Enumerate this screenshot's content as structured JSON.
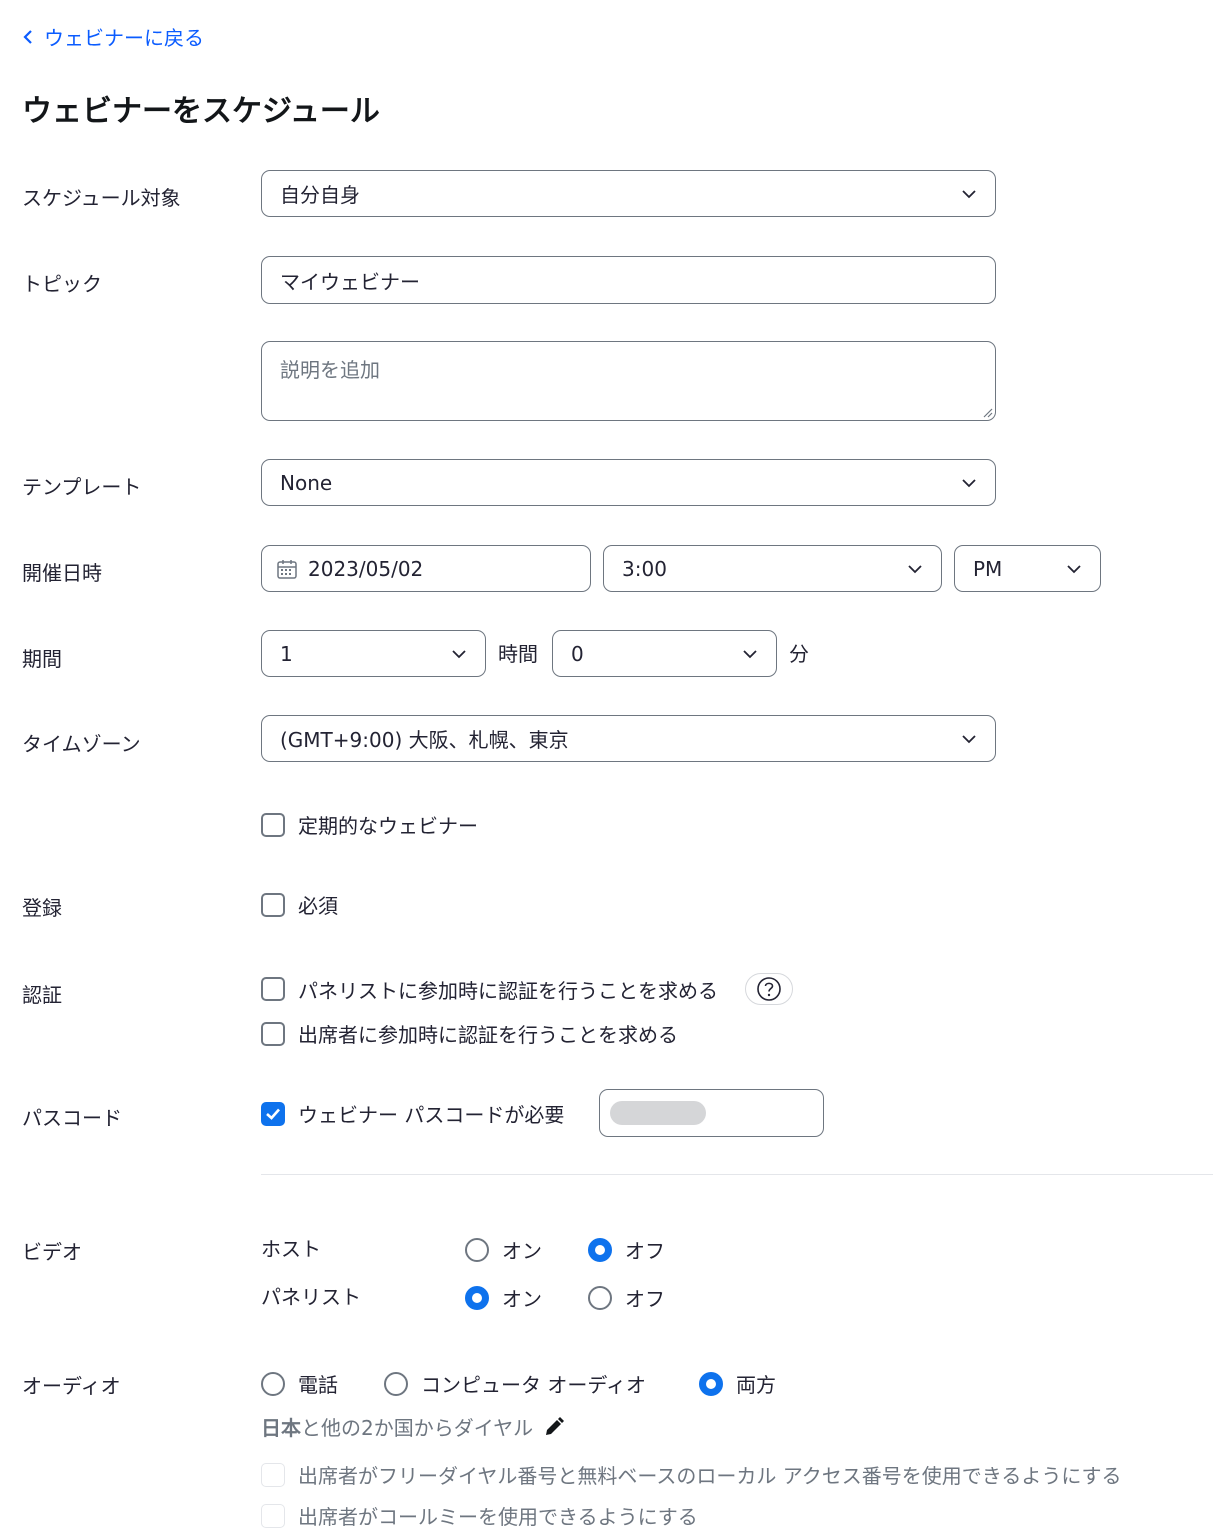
{
  "header": {
    "back_label": "ウェビナーに戻る",
    "page_title": "ウェビナーをスケジュール"
  },
  "form": {
    "schedule_for": {
      "label": "スケジュール対象",
      "value": "自分自身"
    },
    "topic": {
      "label": "トピック",
      "value": "マイウェビナー"
    },
    "description": {
      "placeholder": "説明を追加"
    },
    "template": {
      "label": "テンプレート",
      "value": "None"
    },
    "when": {
      "label": "開催日時",
      "date": "2023/05/02",
      "time": "3:00",
      "ampm": "PM"
    },
    "duration": {
      "label": "期間",
      "hours": "1",
      "hours_unit": "時間",
      "minutes": "0",
      "minutes_unit": "分"
    },
    "timezone": {
      "label": "タイムゾーン",
      "value": "(GMT+9:00) 大阪、札幌、東京"
    },
    "recurring": {
      "label": "定期的なウェビナー",
      "checked": false
    },
    "registration": {
      "label": "登録",
      "option": "必須",
      "checked": false
    },
    "authentication": {
      "label": "認証",
      "panelist_option": "パネリストに参加時に認証を行うことを求める",
      "attendee_option": "出席者に参加時に認証を行うことを求める"
    },
    "passcode": {
      "label": "パスコード",
      "option": "ウェビナー パスコードが必要",
      "checked": true
    },
    "video": {
      "label": "ビデオ",
      "host_label": "ホスト",
      "panelist_label": "パネリスト",
      "on": "オン",
      "off": "オフ",
      "host_value": "off",
      "panelist_value": "on"
    },
    "audio": {
      "label": "オーディオ",
      "options": [
        "電話",
        "コンピュータ オーディオ",
        "両方"
      ],
      "selected": "両方",
      "dial_country": "日本",
      "dial_suffix": "と他の2か国からダイヤル",
      "toll_free_option": "出席者がフリーダイヤル番号と無料ベースのローカル アクセス番号を使用できるようにする",
      "call_me_option": "出席者がコールミーを使用できるようにする"
    }
  },
  "colors": {
    "accent": "#0e72ed",
    "link": "#0b5cff",
    "border": "#6e7680"
  }
}
